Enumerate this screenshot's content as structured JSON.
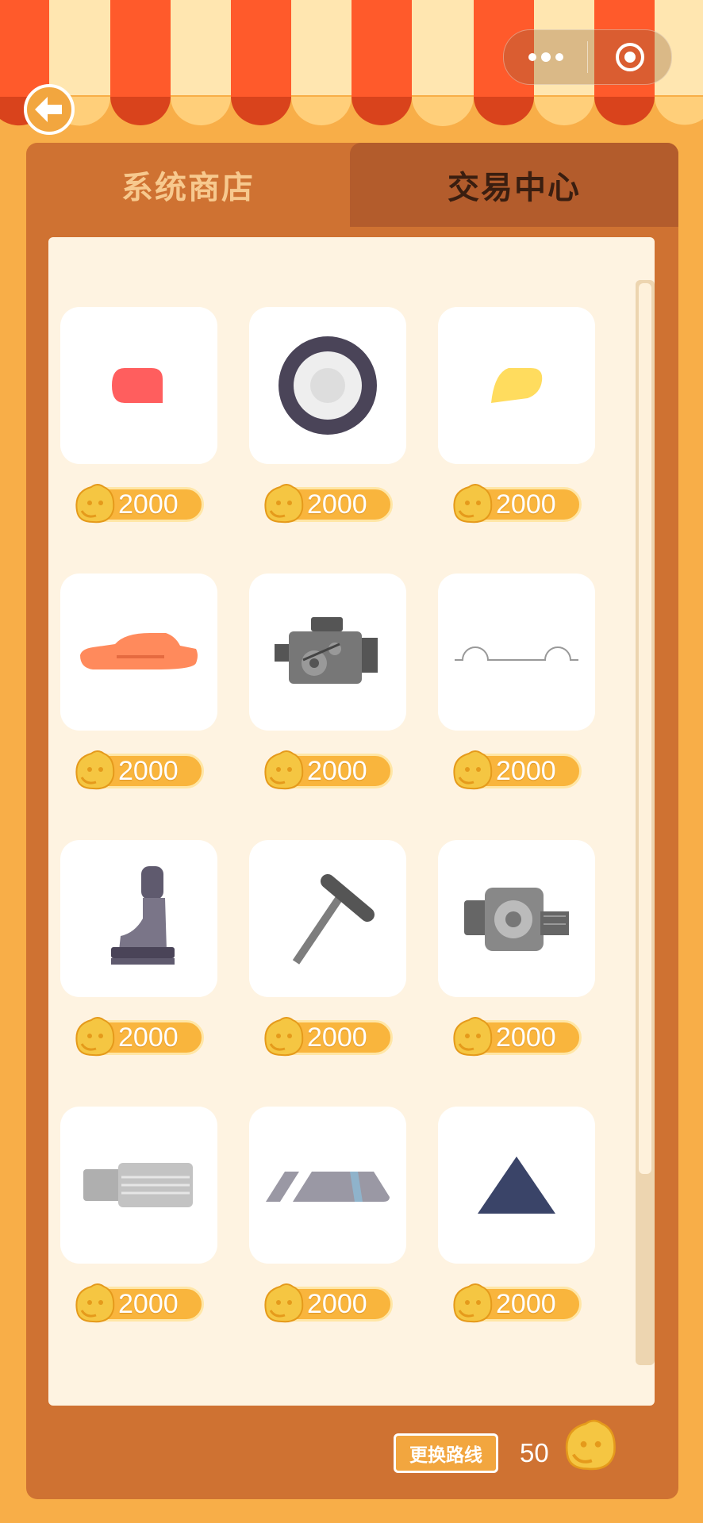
{
  "tabs": {
    "active_label": "系统商店",
    "inactive_label": "交易中心"
  },
  "items": [
    {
      "icon": "red-tail-light-icon",
      "price": "2000"
    },
    {
      "icon": "tire-icon",
      "price": "2000"
    },
    {
      "icon": "yellow-headlight-icon",
      "price": "2000"
    },
    {
      "icon": "car-body-icon",
      "price": "2000"
    },
    {
      "icon": "engine-icon",
      "price": "2000"
    },
    {
      "icon": "chassis-icon",
      "price": "2000"
    },
    {
      "icon": "seat-icon",
      "price": "2000"
    },
    {
      "icon": "steering-column-icon",
      "price": "2000"
    },
    {
      "icon": "motor-icon",
      "price": "2000"
    },
    {
      "icon": "exhaust-pipe-icon",
      "price": "2000"
    },
    {
      "icon": "windshield-icon",
      "price": "2000"
    },
    {
      "icon": "triangle-part-icon",
      "price": "2000"
    }
  ],
  "footer": {
    "change_route_label": "更换路线",
    "coin_balance": "50"
  },
  "colors": {
    "stripe_red": "#FF5A2B",
    "stripe_cream": "#FFE6B0",
    "panel": "#CF7232",
    "tab_inactive": "#B35C2C",
    "list_bg": "#FEF3E1",
    "coin_gold": "#F9B53D"
  }
}
